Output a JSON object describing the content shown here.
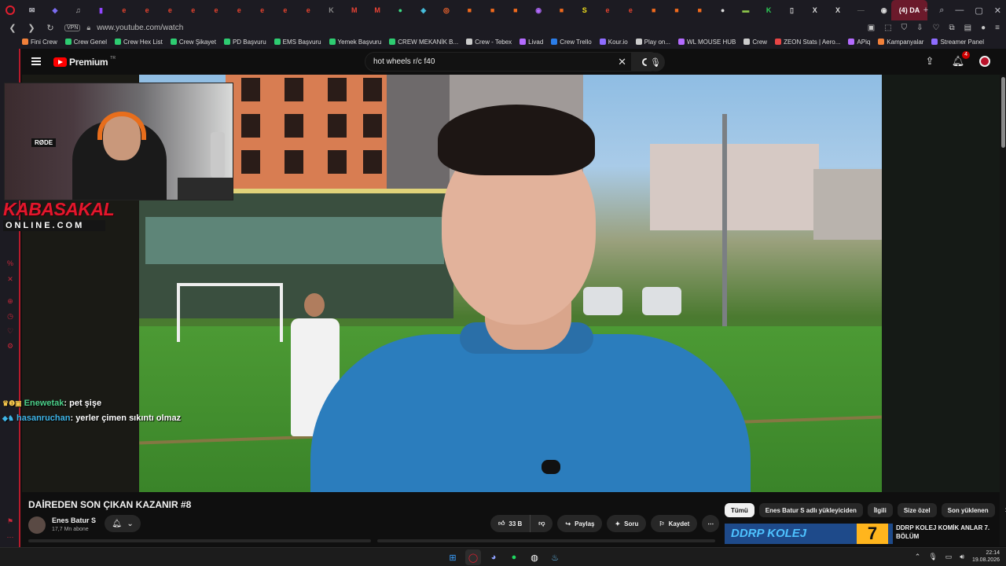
{
  "browser": {
    "active_tab_label": "(4) DA",
    "tab_favicons": [
      {
        "icon": "mail-icon",
        "char": "✉",
        "color": "#c0c0c8"
      },
      {
        "icon": "shield-icon",
        "char": "◆",
        "color": "#7b6cf0"
      },
      {
        "icon": "music-icon",
        "char": "♫",
        "color": "#bbbbbb"
      },
      {
        "icon": "twitch-icon",
        "char": "▮",
        "color": "#9146ff"
      },
      {
        "icon": "e-icon",
        "char": "e",
        "color": "#e8442f"
      },
      {
        "icon": "e-icon",
        "char": "e",
        "color": "#e8442f"
      },
      {
        "icon": "e-icon",
        "char": "e",
        "color": "#e8442f"
      },
      {
        "icon": "e-icon",
        "char": "e",
        "color": "#e8442f"
      },
      {
        "icon": "e-icon",
        "char": "e",
        "color": "#e8442f"
      },
      {
        "icon": "e-icon",
        "char": "e",
        "color": "#e8442f"
      },
      {
        "icon": "e-icon",
        "char": "e",
        "color": "#e8442f"
      },
      {
        "icon": "e-icon",
        "char": "e",
        "color": "#e8442f"
      },
      {
        "icon": "e-icon",
        "char": "e",
        "color": "#e8442f"
      },
      {
        "icon": "kick-icon",
        "char": "K",
        "color": "#888888"
      },
      {
        "icon": "gmail-icon",
        "char": "M",
        "color": "#ea4335"
      },
      {
        "icon": "gmail-icon",
        "char": "M",
        "color": "#ea4335"
      },
      {
        "icon": "android-icon",
        "char": "●",
        "color": "#3ddc84"
      },
      {
        "icon": "game-icon",
        "char": "◈",
        "color": "#49c6e5"
      },
      {
        "icon": "target-icon",
        "char": "◎",
        "color": "#ff6a2f"
      },
      {
        "icon": "orange-icon",
        "char": "■",
        "color": "#f26b1d"
      },
      {
        "icon": "orange-icon",
        "char": "■",
        "color": "#f26b1d"
      },
      {
        "icon": "orange-icon",
        "char": "■",
        "color": "#f26b1d"
      },
      {
        "icon": "controller-icon",
        "char": "◉",
        "color": "#b46bff"
      },
      {
        "icon": "orange-icon",
        "char": "■",
        "color": "#f26b1d"
      },
      {
        "icon": "s-icon",
        "char": "S",
        "color": "#f2e21d"
      },
      {
        "icon": "e-icon",
        "char": "e",
        "color": "#e8442f"
      },
      {
        "icon": "e-icon",
        "char": "e",
        "color": "#e8442f"
      },
      {
        "icon": "orange-icon",
        "char": "■",
        "color": "#f26b1d"
      },
      {
        "icon": "orange-icon",
        "char": "■",
        "color": "#f26b1d"
      },
      {
        "icon": "orange-icon",
        "char": "■",
        "color": "#f26b1d"
      },
      {
        "icon": "github-icon",
        "char": "●",
        "color": "#dddddd"
      },
      {
        "icon": "bar-icon",
        "char": "▬",
        "color": "#8bc34a"
      },
      {
        "icon": "k-icon",
        "char": "K",
        "color": "#2ed158"
      },
      {
        "icon": "doc-icon",
        "char": "▯",
        "color": "#cccccc"
      },
      {
        "icon": "x-icon",
        "char": "X",
        "color": "#dddddd"
      },
      {
        "icon": "x-icon",
        "char": "X",
        "color": "#dddddd"
      },
      {
        "icon": "blank-icon",
        "char": "—",
        "color": "#555555"
      },
      {
        "icon": "chrome-icon",
        "char": "◉",
        "color": "#dddddd"
      },
      {
        "icon": "chrome-icon",
        "char": "◉",
        "color": "#dddddd"
      }
    ],
    "url": "www.youtube.com/watch",
    "vpn_label": "VPN",
    "bookmarks": [
      {
        "label": "Fini Crew",
        "color": "#f2813a"
      },
      {
        "label": "Crew Genel",
        "color": "#2ecc71"
      },
      {
        "label": "Crew Hex List",
        "color": "#2ecc71"
      },
      {
        "label": "Crew Şikayet",
        "color": "#2ecc71"
      },
      {
        "label": "PD Başvuru",
        "color": "#2ecc71"
      },
      {
        "label": "EMS Başvuru",
        "color": "#2ecc71"
      },
      {
        "label": "Yemek Başvuru",
        "color": "#2ecc71"
      },
      {
        "label": "CREW MEKANİK B...",
        "color": "#2ecc71"
      },
      {
        "label": "Crew - Tebex",
        "color": "#cccccc"
      },
      {
        "label": "Livad",
        "color": "#b46bff"
      },
      {
        "label": "Crew Trello",
        "color": "#2b7de9"
      },
      {
        "label": "Kour.io",
        "color": "#8e6cff"
      },
      {
        "label": "Play on...",
        "color": "#cccccc"
      },
      {
        "label": "WL MOUSE HUB",
        "color": "#b46bff"
      },
      {
        "label": "Crew",
        "color": "#cccccc"
      },
      {
        "label": "ZEON Stats | Aero...",
        "color": "#e84545"
      },
      {
        "label": "APiq",
        "color": "#b46bff"
      },
      {
        "label": "Kampanyalar",
        "color": "#f2813a"
      },
      {
        "label": "Streamer Panel",
        "color": "#8e6cff"
      }
    ]
  },
  "youtube": {
    "logo_text": "Premium",
    "logo_region": "TR",
    "search_value": "hot wheels r/c f40",
    "notification_count": "4"
  },
  "overlay": {
    "brand_top": "KABASAKAL",
    "brand_bottom": "ONLINE.COM",
    "webcam_mic_label": "RØDE",
    "chat": [
      {
        "user": "Enewetak",
        "message": ": pet şişe"
      },
      {
        "user": "hasanruchan",
        "message": ": yerler çimen sıkıntı olmaz"
      }
    ]
  },
  "video": {
    "title": "DAİREDEN SON ÇIKAN KAZANIR #8",
    "channel_name": "Enes Batur S",
    "subscribers": "17,7 Mn abone",
    "like_count": "33 B",
    "share_label": "Paylaş",
    "ask_label": "Soru",
    "save_label": "Kaydet"
  },
  "chips": [
    "Tümü",
    "Enes Batur S adlı yükleyiciden",
    "İlgili",
    "Size özel",
    "Son yüklenen"
  ],
  "recommendation": {
    "thumb_text": "DDRP KOLEJ",
    "thumb_number": "7",
    "title": "DDRP KOLEJ KOMİK ANLAR 7. BÖLÜM"
  },
  "taskbar": {
    "time": "22:14",
    "date": "19.08.2026"
  }
}
